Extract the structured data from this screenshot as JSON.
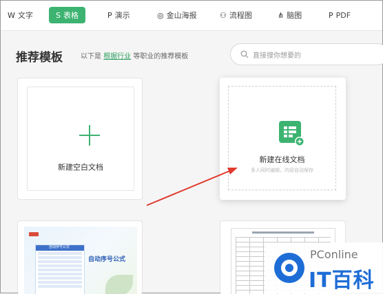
{
  "tabs": [
    {
      "icon": "W",
      "label": "文字",
      "active": false
    },
    {
      "icon": "S",
      "label": "表格",
      "active": true
    },
    {
      "icon": "P",
      "label": "演示",
      "active": false
    },
    {
      "icon": "◎",
      "label": "金山海报",
      "active": false
    },
    {
      "icon": "⚇",
      "label": "流程图",
      "active": false
    },
    {
      "icon": "⋔",
      "label": "脑图",
      "active": false
    },
    {
      "icon": "P",
      "label": "PDF",
      "active": false
    }
  ],
  "section": {
    "title": "推荐模板",
    "subtitle_prefix": "以下是",
    "subtitle_link": "根据行业",
    "subtitle_suffix": "等职业的推荐模板"
  },
  "search": {
    "placeholder": "直接搜你想要的"
  },
  "cards": {
    "blank": {
      "label": "新建空白文档"
    },
    "online": {
      "label": "新建在线文档",
      "desc": "多人同时编辑，内容自动保存"
    }
  },
  "templates": [
    {
      "title": "自动序号公式",
      "table_name": "自动序号公式"
    }
  ],
  "watermark": {
    "line1": "PConline",
    "line2": "IT百科"
  },
  "colors": {
    "accent": "#3cb371",
    "arrow": "#e03a2e",
    "brand_blue": "#1e6dd6"
  }
}
